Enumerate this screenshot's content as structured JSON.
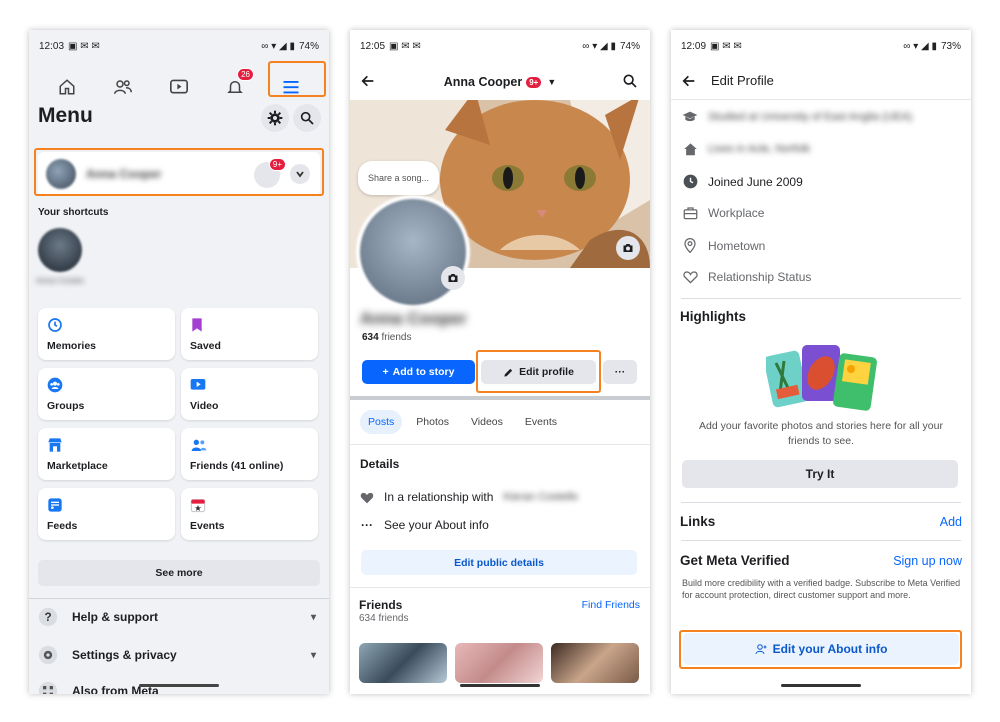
{
  "colors": {
    "highlight": "#f5821f",
    "facebook_blue": "#0866ff",
    "badge_red": "#e41e3f"
  },
  "phone1": {
    "status_time": "12:03",
    "battery": "74%",
    "notification_badge": "26",
    "title": "Menu",
    "profile_name": "Anna Cooper",
    "profile_badge": "9+",
    "shortcuts_label": "Your shortcuts",
    "shortcut_name": "Kieran Costello",
    "tiles": [
      {
        "label": "Memories",
        "icon": "clock-icon"
      },
      {
        "label": "Saved",
        "icon": "bookmark-icon"
      },
      {
        "label": "Groups",
        "icon": "groups-icon"
      },
      {
        "label": "Video",
        "icon": "video-icon"
      },
      {
        "label": "Marketplace",
        "icon": "store-icon"
      },
      {
        "label": "Friends (41 online)",
        "icon": "friends-icon"
      },
      {
        "label": "Feeds",
        "icon": "feeds-icon"
      },
      {
        "label": "Events",
        "icon": "calendar-icon"
      }
    ],
    "see_more": "See more",
    "help": "Help & support",
    "settings": "Settings & privacy",
    "also_from_meta": "Also from Meta"
  },
  "phone2": {
    "status_time": "12:05",
    "battery": "74%",
    "header_name": "Anna Cooper",
    "header_badge": "9+",
    "song_placeholder": "Share a song...",
    "profile_name": "Anna Cooper",
    "friends_count": "634",
    "friends_word": "friends",
    "add_story": "Add to story",
    "edit_profile": "Edit profile",
    "more": "···",
    "tabs": [
      "Posts",
      "Photos",
      "Videos",
      "Events"
    ],
    "details_title": "Details",
    "relationship_prefix": "In a relationship with",
    "relationship_name": "Kieran Costello",
    "see_about": "See your About info",
    "edit_public": "Edit public details",
    "friends_title": "Friends",
    "friends_sub": "634 friends",
    "find_friends": "Find Friends"
  },
  "phone3": {
    "status_time": "12:09",
    "battery": "73%",
    "header": "Edit Profile",
    "studied": "Studied at University of East Anglia (UEA)",
    "lives": "Lives in Acle, Norfolk",
    "joined": "Joined June 2009",
    "workplace": "Workplace",
    "hometown": "Hometown",
    "relationship": "Relationship Status",
    "highlights_title": "Highlights",
    "highlights_desc": "Add your favorite photos and stories here for all your friends to see.",
    "try_it": "Try It",
    "links_title": "Links",
    "links_action": "Add",
    "mv_title": "Get Meta Verified",
    "mv_action": "Sign up now",
    "mv_desc": "Build more credibility with a verified badge. Subscribe to Meta Verified for account protection, direct customer support and more.",
    "edit_about": "Edit your About info"
  }
}
